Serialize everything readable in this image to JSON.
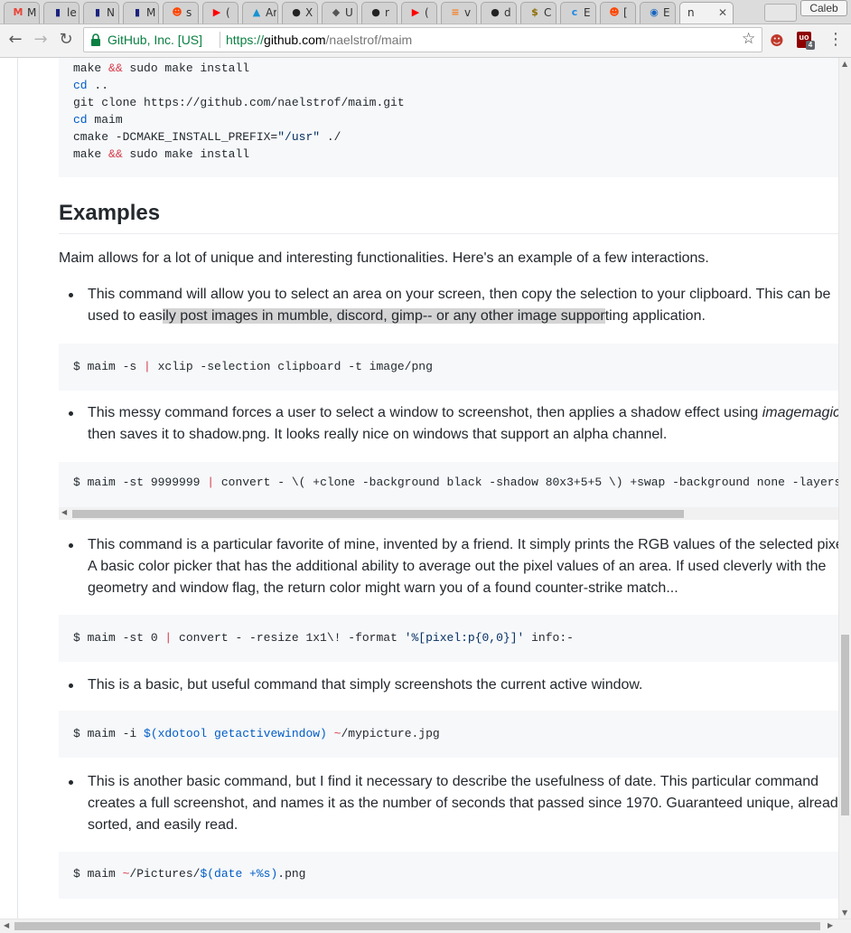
{
  "browser": {
    "tabs": [
      {
        "title": "M",
        "icon": "gmail-icon",
        "color": "#ea4335"
      },
      {
        "title": "le",
        "icon": "flag-icon",
        "color": "#1a237e"
      },
      {
        "title": "N",
        "icon": "flag-icon",
        "color": "#1a237e"
      },
      {
        "title": "M",
        "icon": "flag-icon",
        "color": "#1a237e"
      },
      {
        "title": "s",
        "icon": "reddit-icon",
        "color": "#ff4500"
      },
      {
        "title": "(",
        "icon": "youtube-icon",
        "color": "#ff0000"
      },
      {
        "title": "Ar",
        "icon": "arch-icon",
        "color": "#1793d1"
      },
      {
        "title": "X",
        "icon": "github-icon",
        "color": "#222222"
      },
      {
        "title": "U",
        "icon": "tux-icon",
        "color": "#555555"
      },
      {
        "title": "r",
        "icon": "github-icon",
        "color": "#222222"
      },
      {
        "title": "(",
        "icon": "youtube-icon",
        "color": "#ff0000"
      },
      {
        "title": "v",
        "icon": "stackoverflow-icon",
        "color": "#f48024"
      },
      {
        "title": "d",
        "icon": "github-icon",
        "color": "#222222"
      },
      {
        "title": "C",
        "icon": "dollar-icon",
        "color": "#8d6e00"
      },
      {
        "title": "E",
        "icon": "c-icon",
        "color": "#1e88e5"
      },
      {
        "title": "[",
        "icon": "reddit-icon",
        "color": "#ff4500"
      },
      {
        "title": "E",
        "icon": "chart-icon",
        "color": "#1565c0"
      },
      {
        "title": "n",
        "icon": "none",
        "color": "#333333",
        "active": true
      }
    ],
    "profile_name": "Caleb",
    "secure_label": "GitHub, Inc. [US]",
    "url_scheme": "https://",
    "url_host": "github.com",
    "url_path": "/naelstrof/maim",
    "extension_badge": "4",
    "extension_label": "uo"
  },
  "readme": {
    "install_code": [
      [
        {
          "t": "make ",
          "c": ""
        },
        {
          "t": "&&",
          "c": "op"
        },
        {
          "t": " sudo make install",
          "c": ""
        }
      ],
      [
        {
          "t": "cd",
          "c": "kw"
        },
        {
          "t": " ..",
          "c": ""
        }
      ],
      [
        {
          "t": "git clone https://github.com/naelstrof/maim.git",
          "c": ""
        }
      ],
      [
        {
          "t": "cd",
          "c": "kw"
        },
        {
          "t": " maim",
          "c": ""
        }
      ],
      [
        {
          "t": "cmake -DCMAKE_INSTALL_PREFIX=",
          "c": ""
        },
        {
          "t": "\"/usr\"",
          "c": "str"
        },
        {
          "t": " ./",
          "c": ""
        }
      ],
      [
        {
          "t": "make ",
          "c": ""
        },
        {
          "t": "&&",
          "c": "op"
        },
        {
          "t": " sudo make install",
          "c": ""
        }
      ]
    ],
    "examples_heading": "Examples",
    "intro": "Maim allows for a lot of unique and interesting functionalities. Here's an example of a few interactions.",
    "bullet1_line1": "This command will allow you to select an area on your screen, then copy the selection to your clipboard. This can be",
    "bullet1_line2_pre": "used to eas",
    "bullet1_line2_hl": "ily post images in mumble, discord, gimp-- or any other image suppor",
    "bullet1_line2_post": "ting application.",
    "code1": [
      {
        "t": "$ maim -s ",
        "c": ""
      },
      {
        "t": "|",
        "c": "op"
      },
      {
        "t": " xclip -selection clipboard -t image/png",
        "c": ""
      }
    ],
    "bullet2_line1_pre": "This messy command forces a user to select a window to screenshot, then applies a shadow effect using ",
    "bullet2_line1_em": "imagemagick",
    "bullet2_line2": "then saves it to shadow.png. It looks really nice on windows that support an alpha channel.",
    "code2": [
      {
        "t": "$ maim -st 9999999 ",
        "c": ""
      },
      {
        "t": "|",
        "c": "op"
      },
      {
        "t": " convert - \\( +clone -background black -shadow 80x3+5+5 \\) +swap -background none -layers merge +repage shadow.png",
        "c": ""
      }
    ],
    "bullet3_line1": "This command is a particular favorite of mine, invented by a friend. It simply prints the RGB values of the selected pixel.",
    "bullet3_line2": "A basic color picker that has the additional ability to average out the pixel values of an area. If used cleverly with the",
    "bullet3_line3": "geometry and window flag, the return color might warn you of a found counter-strike match...",
    "code3": [
      {
        "t": "$ maim -st 0 ",
        "c": ""
      },
      {
        "t": "|",
        "c": "op"
      },
      {
        "t": " convert - -resize 1x1\\! -format ",
        "c": ""
      },
      {
        "t": "'%[pixel:p{0,0}]'",
        "c": "str"
      },
      {
        "t": " info:-",
        "c": ""
      }
    ],
    "bullet4": "This is a basic, but useful command that simply screenshots the current active window.",
    "code4": [
      {
        "t": "$ maim -i ",
        "c": ""
      },
      {
        "t": "$(xdotool getactivewindow)",
        "c": "kw"
      },
      {
        "t": " ",
        "c": ""
      },
      {
        "t": "~",
        "c": "op"
      },
      {
        "t": "/mypicture.jpg",
        "c": ""
      }
    ],
    "bullet5_line1": "This is another basic command, but I find it necessary to describe the usefulness of date. This particular command",
    "bullet5_line2": "creates a full screenshot, and names it as the number of seconds that passed since 1970. Guaranteed unique, already",
    "bullet5_line3": "sorted, and easily read.",
    "code5": [
      {
        "t": "$ maim ",
        "c": ""
      },
      {
        "t": "~",
        "c": "op"
      },
      {
        "t": "/Pictures/",
        "c": ""
      },
      {
        "t": "$(date +%s)",
        "c": "kw"
      },
      {
        "t": ".png",
        "c": ""
      }
    ]
  }
}
